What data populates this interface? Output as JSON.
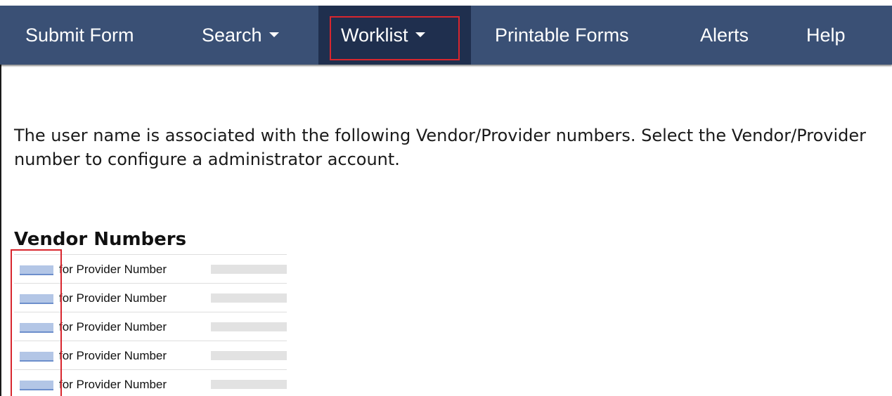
{
  "nav": {
    "items": [
      {
        "label": "Submit Form",
        "has_caret": false
      },
      {
        "label": "Search",
        "has_caret": true
      },
      {
        "label": "Worklist",
        "has_caret": true,
        "active": true,
        "highlighted": true
      },
      {
        "label": "Printable Forms",
        "has_caret": false
      },
      {
        "label": "Alerts",
        "has_caret": false
      },
      {
        "label": "Help",
        "has_caret": false
      }
    ]
  },
  "main": {
    "intro_text": "The user name is associated with the following Vendor/Provider numbers. Select the Vendor/Provider number to configure a administrator account.",
    "section_title": "Vendor Numbers",
    "vendor_rows": [
      {
        "connector_label": "for Provider Number"
      },
      {
        "connector_label": "for Provider Number"
      },
      {
        "connector_label": "for Provider Number"
      },
      {
        "connector_label": "for Provider Number"
      },
      {
        "connector_label": "for Provider Number"
      }
    ]
  },
  "colors": {
    "navbar_bg": "#3a5075",
    "navbar_active_bg": "#1f2f4e",
    "highlight": "#d8262e",
    "link_redacted": "#b3c6e6",
    "text_redacted": "#e2e2e2"
  }
}
